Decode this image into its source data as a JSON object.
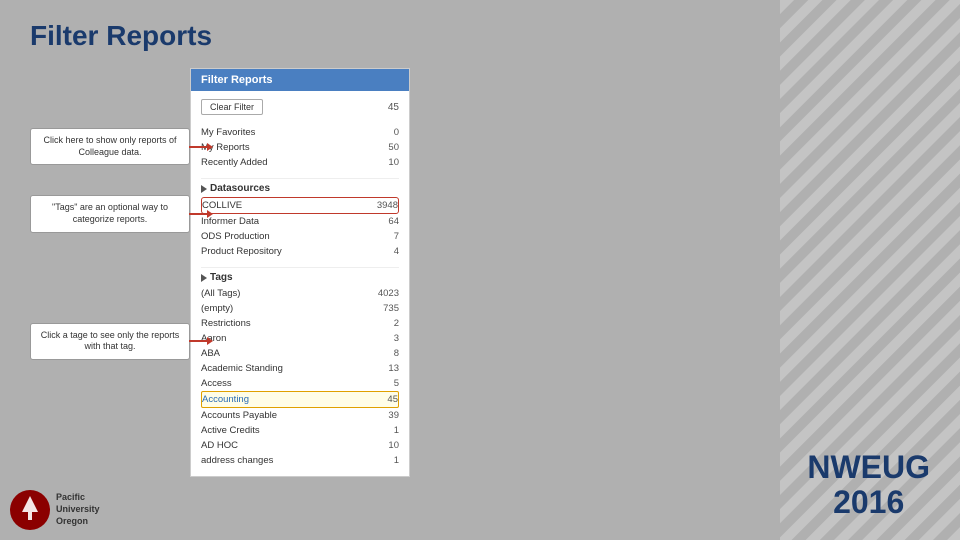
{
  "page": {
    "title": "Filter Reports",
    "background_color": "#b0b0b0"
  },
  "filter_panel": {
    "header": "Filter Reports",
    "clear_filter_label": "Clear Filter",
    "total_count": "45",
    "my_favorites": {
      "label": "My Favorites",
      "count": "0"
    },
    "my_reports": {
      "label": "My Reports",
      "count": "50"
    },
    "recently_added": {
      "label": "Recently Added",
      "count": "10"
    },
    "datasources_section": "Datasources",
    "datasources": [
      {
        "label": "COLLIVE",
        "count": "3948",
        "highlighted": true
      },
      {
        "label": "Informer Data",
        "count": "64"
      },
      {
        "label": "ODS Production",
        "count": "7"
      },
      {
        "label": "Product Repository",
        "count": "4"
      }
    ],
    "tags_section": "Tags",
    "tags": [
      {
        "label": "(All Tags)",
        "count": "4023"
      },
      {
        "label": "(empty)",
        "count": "735"
      },
      {
        "label": "Restrictions",
        "count": "2"
      },
      {
        "label": "Aaron",
        "count": "3"
      },
      {
        "label": "ABA",
        "count": "8"
      },
      {
        "label": "Academic Standing",
        "count": "13"
      },
      {
        "label": "Access",
        "count": "5"
      },
      {
        "label": "Accounting",
        "count": "45",
        "highlighted": true
      },
      {
        "label": "Accounts Payable",
        "count": "39"
      },
      {
        "label": "Active Credits",
        "count": "1"
      },
      {
        "label": "AD HOC",
        "count": "10"
      },
      {
        "label": "address changes",
        "count": "1"
      }
    ]
  },
  "callouts": [
    {
      "id": "callout-1",
      "text": "Click here to show only reports of Colleague data."
    },
    {
      "id": "callout-2",
      "text": "\"Tags\" are an optional way to categorize reports."
    },
    {
      "id": "callout-3",
      "text": "Click a tage to see only the reports with that tag."
    }
  ],
  "logo": {
    "text": "Pacific\nUniversity\nOregon"
  },
  "nweug": {
    "line1": "NWEUG",
    "line2": "2016"
  }
}
